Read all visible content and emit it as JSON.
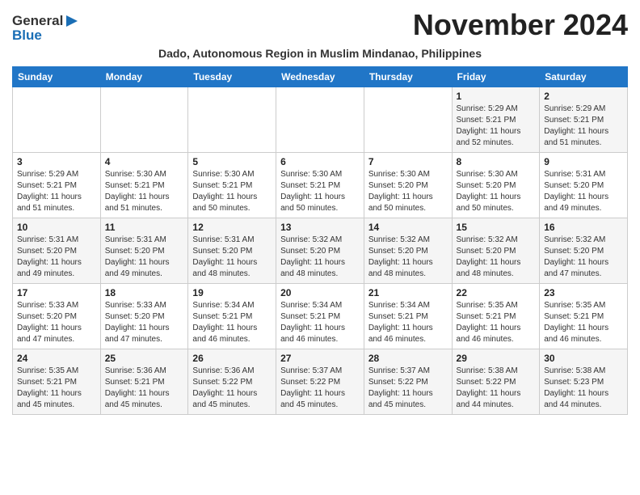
{
  "header": {
    "logo_line1": "General",
    "logo_line2": "Blue",
    "month_title": "November 2024",
    "subtitle": "Dado, Autonomous Region in Muslim Mindanao, Philippines"
  },
  "weekdays": [
    "Sunday",
    "Monday",
    "Tuesday",
    "Wednesday",
    "Thursday",
    "Friday",
    "Saturday"
  ],
  "weeks": [
    [
      {
        "day": "",
        "info": ""
      },
      {
        "day": "",
        "info": ""
      },
      {
        "day": "",
        "info": ""
      },
      {
        "day": "",
        "info": ""
      },
      {
        "day": "",
        "info": ""
      },
      {
        "day": "1",
        "info": "Sunrise: 5:29 AM\nSunset: 5:21 PM\nDaylight: 11 hours\nand 52 minutes."
      },
      {
        "day": "2",
        "info": "Sunrise: 5:29 AM\nSunset: 5:21 PM\nDaylight: 11 hours\nand 51 minutes."
      }
    ],
    [
      {
        "day": "3",
        "info": "Sunrise: 5:29 AM\nSunset: 5:21 PM\nDaylight: 11 hours\nand 51 minutes."
      },
      {
        "day": "4",
        "info": "Sunrise: 5:30 AM\nSunset: 5:21 PM\nDaylight: 11 hours\nand 51 minutes."
      },
      {
        "day": "5",
        "info": "Sunrise: 5:30 AM\nSunset: 5:21 PM\nDaylight: 11 hours\nand 50 minutes."
      },
      {
        "day": "6",
        "info": "Sunrise: 5:30 AM\nSunset: 5:21 PM\nDaylight: 11 hours\nand 50 minutes."
      },
      {
        "day": "7",
        "info": "Sunrise: 5:30 AM\nSunset: 5:20 PM\nDaylight: 11 hours\nand 50 minutes."
      },
      {
        "day": "8",
        "info": "Sunrise: 5:30 AM\nSunset: 5:20 PM\nDaylight: 11 hours\nand 50 minutes."
      },
      {
        "day": "9",
        "info": "Sunrise: 5:31 AM\nSunset: 5:20 PM\nDaylight: 11 hours\nand 49 minutes."
      }
    ],
    [
      {
        "day": "10",
        "info": "Sunrise: 5:31 AM\nSunset: 5:20 PM\nDaylight: 11 hours\nand 49 minutes."
      },
      {
        "day": "11",
        "info": "Sunrise: 5:31 AM\nSunset: 5:20 PM\nDaylight: 11 hours\nand 49 minutes."
      },
      {
        "day": "12",
        "info": "Sunrise: 5:31 AM\nSunset: 5:20 PM\nDaylight: 11 hours\nand 48 minutes."
      },
      {
        "day": "13",
        "info": "Sunrise: 5:32 AM\nSunset: 5:20 PM\nDaylight: 11 hours\nand 48 minutes."
      },
      {
        "day": "14",
        "info": "Sunrise: 5:32 AM\nSunset: 5:20 PM\nDaylight: 11 hours\nand 48 minutes."
      },
      {
        "day": "15",
        "info": "Sunrise: 5:32 AM\nSunset: 5:20 PM\nDaylight: 11 hours\nand 48 minutes."
      },
      {
        "day": "16",
        "info": "Sunrise: 5:32 AM\nSunset: 5:20 PM\nDaylight: 11 hours\nand 47 minutes."
      }
    ],
    [
      {
        "day": "17",
        "info": "Sunrise: 5:33 AM\nSunset: 5:20 PM\nDaylight: 11 hours\nand 47 minutes."
      },
      {
        "day": "18",
        "info": "Sunrise: 5:33 AM\nSunset: 5:20 PM\nDaylight: 11 hours\nand 47 minutes."
      },
      {
        "day": "19",
        "info": "Sunrise: 5:34 AM\nSunset: 5:21 PM\nDaylight: 11 hours\nand 46 minutes."
      },
      {
        "day": "20",
        "info": "Sunrise: 5:34 AM\nSunset: 5:21 PM\nDaylight: 11 hours\nand 46 minutes."
      },
      {
        "day": "21",
        "info": "Sunrise: 5:34 AM\nSunset: 5:21 PM\nDaylight: 11 hours\nand 46 minutes."
      },
      {
        "day": "22",
        "info": "Sunrise: 5:35 AM\nSunset: 5:21 PM\nDaylight: 11 hours\nand 46 minutes."
      },
      {
        "day": "23",
        "info": "Sunrise: 5:35 AM\nSunset: 5:21 PM\nDaylight: 11 hours\nand 46 minutes."
      }
    ],
    [
      {
        "day": "24",
        "info": "Sunrise: 5:35 AM\nSunset: 5:21 PM\nDaylight: 11 hours\nand 45 minutes."
      },
      {
        "day": "25",
        "info": "Sunrise: 5:36 AM\nSunset: 5:21 PM\nDaylight: 11 hours\nand 45 minutes."
      },
      {
        "day": "26",
        "info": "Sunrise: 5:36 AM\nSunset: 5:22 PM\nDaylight: 11 hours\nand 45 minutes."
      },
      {
        "day": "27",
        "info": "Sunrise: 5:37 AM\nSunset: 5:22 PM\nDaylight: 11 hours\nand 45 minutes."
      },
      {
        "day": "28",
        "info": "Sunrise: 5:37 AM\nSunset: 5:22 PM\nDaylight: 11 hours\nand 45 minutes."
      },
      {
        "day": "29",
        "info": "Sunrise: 5:38 AM\nSunset: 5:22 PM\nDaylight: 11 hours\nand 44 minutes."
      },
      {
        "day": "30",
        "info": "Sunrise: 5:38 AM\nSunset: 5:23 PM\nDaylight: 11 hours\nand 44 minutes."
      }
    ]
  ]
}
